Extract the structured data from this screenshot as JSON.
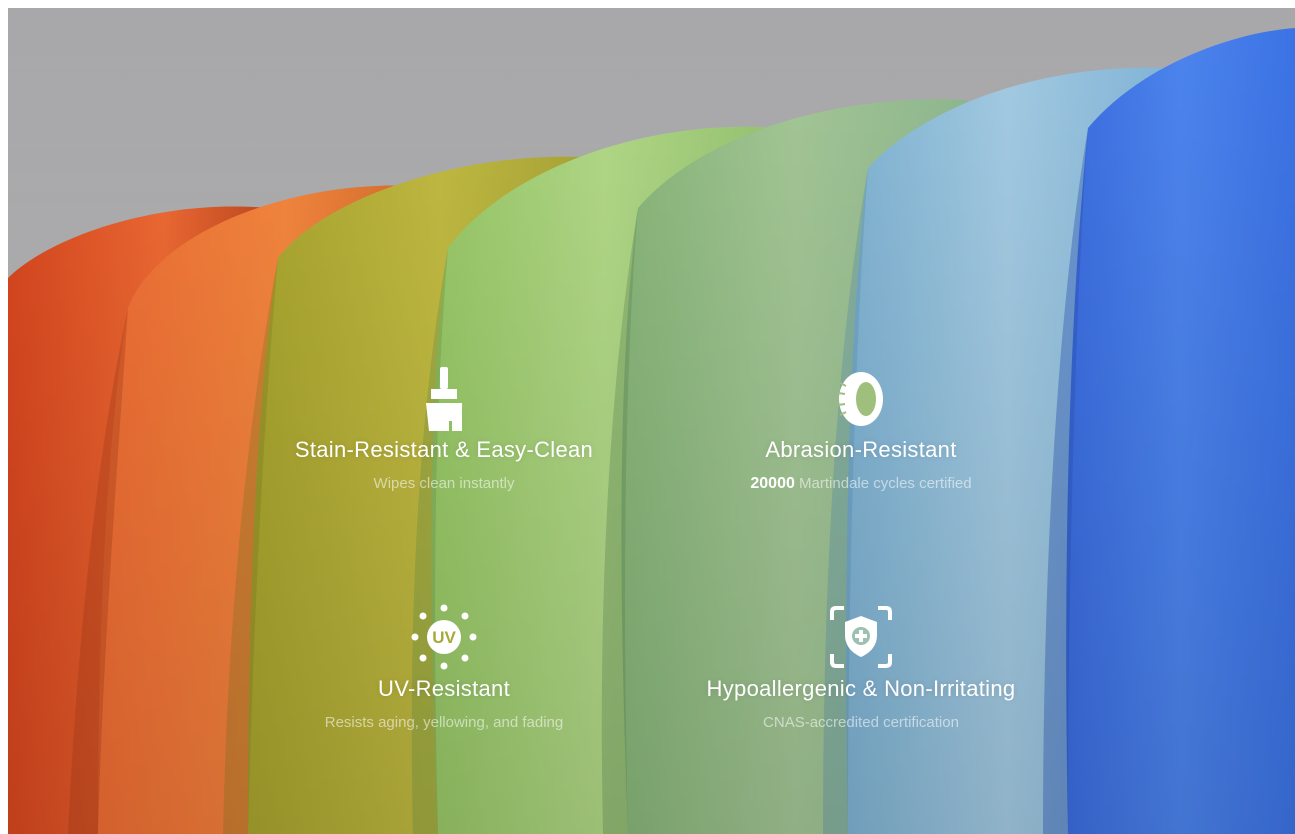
{
  "features": [
    {
      "icon": "brush-icon",
      "title": "Stain-Resistant & Easy-Clean",
      "description": "Wipes clean instantly"
    },
    {
      "icon": "tire-icon",
      "title": "Abrasion-Resistant",
      "description_highlight": "20000",
      "description": "Martindale cycles certified"
    },
    {
      "icon": "uv-sun-icon",
      "icon_text": "UV",
      "title": "UV-Resistant",
      "description": "Resists aging, yellowing, and fading"
    },
    {
      "icon": "shield-plus-icon",
      "title": "Hypoallergenic & Non-Irritating",
      "description": "CNAS-accredited certification"
    }
  ],
  "colors": {
    "backdrop": "#a9a9ab",
    "fabric_swatches": [
      "#e8562a",
      "#f07a3a",
      "#b7b03a",
      "#a8d27a",
      "#9cc48a",
      "#8ec0da",
      "#3f74e8"
    ]
  }
}
